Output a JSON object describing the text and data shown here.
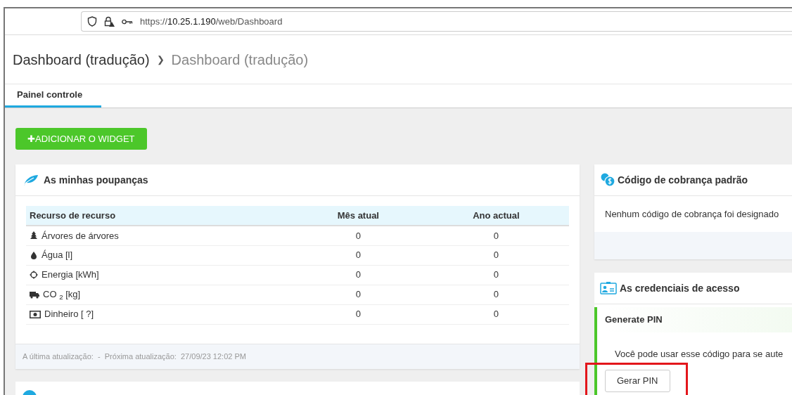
{
  "browser": {
    "url_scheme": "https://",
    "url_host": "10.25.1.190",
    "url_path": "/web/Dashboard"
  },
  "breadcrumb": [
    "Dashboard (tradução)",
    "Dashboard (tradução)"
  ],
  "breadcrumb_separator": "❯",
  "tabs": [
    {
      "label": "Painel controle",
      "selected": true
    }
  ],
  "add_widget_button": {
    "icon": "✚",
    "label": "ADICIONAR O WIDGET"
  },
  "savings": {
    "title": "As minhas poupanças",
    "columns": [
      "Recurso de recurso",
      "Mês atual",
      "Ano actual"
    ],
    "rows": [
      {
        "kind": "tree",
        "label": "Árvores de árvores",
        "month": "0",
        "year": "0"
      },
      {
        "kind": "water",
        "label": "Água [l]",
        "month": "0",
        "year": "0"
      },
      {
        "kind": "energy",
        "label": "Energia [kWh]",
        "month": "0",
        "year": "0"
      },
      {
        "kind": "co2",
        "label": "CO $_{2}$ [kg]",
        "month": "0",
        "year": "0"
      },
      {
        "kind": "money",
        "label": "Dinheiro [ ?]",
        "month": "0",
        "year": "0"
      }
    ],
    "footer": "A última atualização:  -  Próxima atualização:  27/09/23 12:02 PM"
  },
  "billing": {
    "title": "Código de cobrança padrão",
    "message": "Nenhum código de cobrança foi designado"
  },
  "credentials": {
    "title": "As credenciais de acesso",
    "section": "Generate PIN",
    "text": "Você pode usar esse código para se aute",
    "button": {
      "label": "Gerar PIN",
      "highlighted": true
    }
  }
}
